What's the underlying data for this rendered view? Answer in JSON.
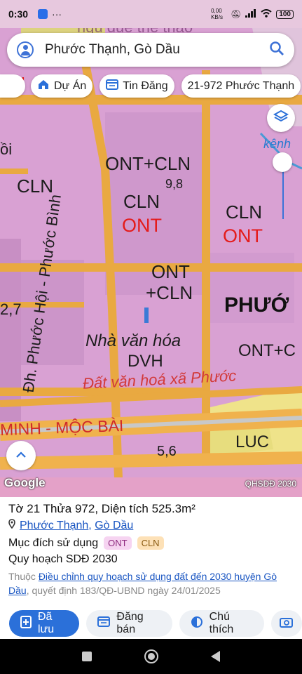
{
  "status_bar": {
    "time": "0:30",
    "dots": "···",
    "net_speed": "0,00 KB/s",
    "battery": "100"
  },
  "search": {
    "query": "Phước Thạnh, Gò Dầu"
  },
  "chips": [
    {
      "label": "Dự Án",
      "icon": "home-icon"
    },
    {
      "label": "Tin Đăng",
      "icon": "listing-icon"
    },
    {
      "label": "21-972 Phước Thạnh",
      "icon": ""
    }
  ],
  "map": {
    "labels": {
      "ont_cln_top": "ONT+CLN",
      "elev_1": "9,8",
      "cln_left": "CLN",
      "cln_mid": "CLN",
      "ont_mid": "ONT",
      "cln_right": "CLN",
      "ont_right": "ONT",
      "ont_center": "ONT",
      "cln_center": "+CLN",
      "phuoc_bold": "PHƯỚ",
      "ont_c_right": "ONT+C",
      "road_vertical": "Đh. Phước Hội - Phước Bình",
      "nha_van_hoa": "Nhà văn hóa",
      "dvh": "DVH",
      "dat_van_hoa": "Đất văn hoá xã Phước",
      "minh_moc_bai": "MINH - MỘC BÀI",
      "elev_2": "5,6",
      "luc": "LUC",
      "elev_3": "2,7",
      "oi": "ồi",
      "kenh": "kênh",
      "ph_top": "PH",
      "top_faint": "rigu due the thao"
    },
    "google": "Google",
    "layer_tag": "QHSDĐ 2030"
  },
  "parcel": {
    "title": "Tờ 21 Thửa 972, Diện tích 525.3m²",
    "ward": "Phước Thạnh",
    "separator": ", ",
    "district": "Gò Dầu",
    "purpose_label": "Mục đích sử dụng",
    "purpose_tags": [
      "ONT",
      "CLN"
    ],
    "plan_label": "Quy hoạch SDĐ 2030",
    "note_prefix": "Thuộc ",
    "note_link": "Điều chỉnh quy hoạch sử dụng đất đến 2030 huyện Gò Dầu",
    "note_suffix": ", quyết định 183/QĐ-UBND ngày 24/01/2025"
  },
  "actions": {
    "saved": "Đã lưu",
    "post": "Đăng bán",
    "note": "Chú thích"
  },
  "colors": {
    "accent": "#2b70d9",
    "map_bg": "#d9a1d3",
    "road": "#e8a93e",
    "tag_ont": "#f6d4f1",
    "tag_cln": "#fde1b7"
  }
}
